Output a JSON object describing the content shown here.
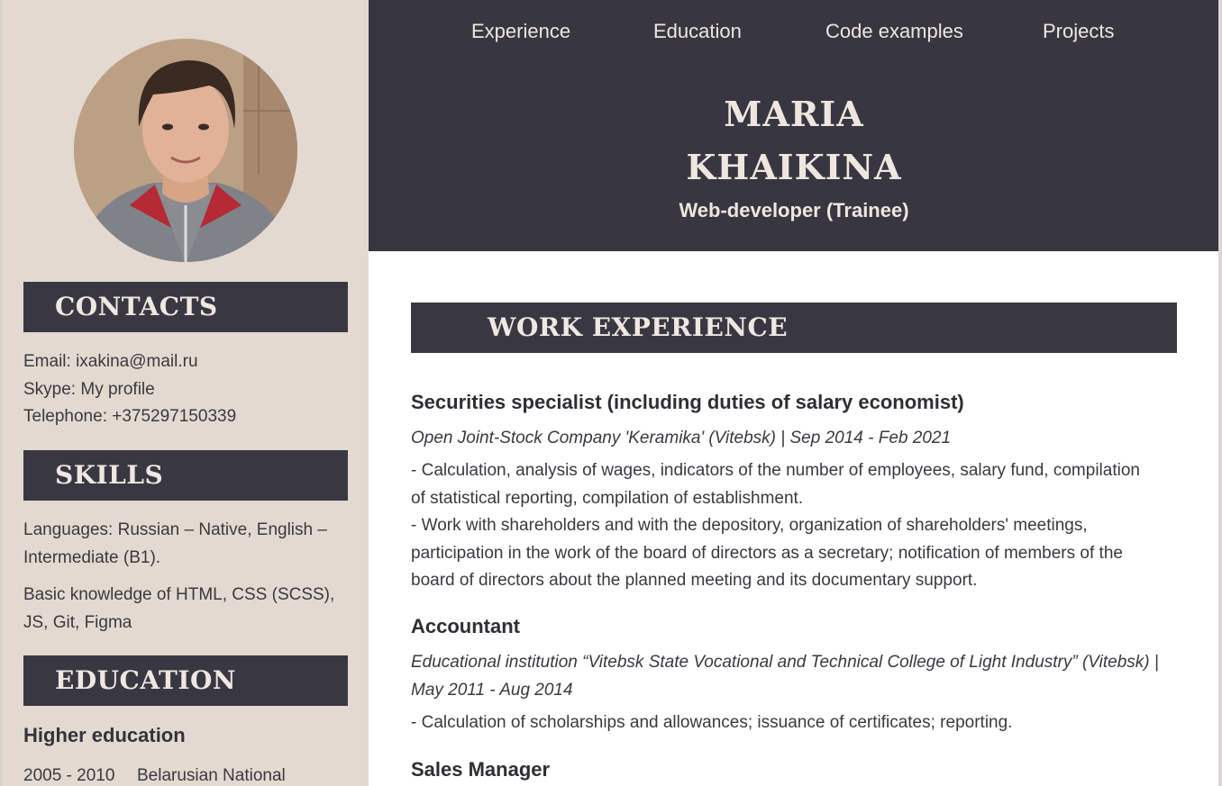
{
  "nav": {
    "items": [
      "Experience",
      "Education",
      "Code examples",
      "Projects"
    ]
  },
  "header": {
    "first_name": "MARIA",
    "last_name": "KHAIKINA",
    "role": "Web-developer (Trainee)"
  },
  "sidebar": {
    "contacts": {
      "heading": "CONTACTS",
      "email": "Email: ixakina@mail.ru",
      "skype": "Skype: My profile",
      "telephone": "Telephone: +375297150339"
    },
    "skills": {
      "heading": "SKILLS",
      "languages_lines": [
        "Languages: Russian – Native, English –",
        "Intermediate (B1)."
      ],
      "knowledge_lines": [
        "Basic knowledge of HTML, CSS (SCSS),",
        "JS, Git, Figma"
      ]
    },
    "education": {
      "heading": "EDUCATION",
      "sub_heading": "Higher education",
      "entry_years": "2005 - 2010",
      "entry_place": "Belarusian National"
    }
  },
  "main": {
    "work_heading": "WORK EXPERIENCE",
    "jobs": [
      {
        "title": "Securities specialist (including duties of salary economist)",
        "company_lines": [
          "Open Joint-Stock Company 'Keramika' (Vitebsk) | Sep 2014 - Feb 2021"
        ],
        "desc_lines": [
          "- Calculation, analysis of wages, indicators of the number of employees, salary fund, compilation",
          "of statistical reporting, compilation of establishment.",
          "- Work with shareholders and with the depository, organization of shareholders' meetings,",
          "participation in the work of the board of directors as a secretary; notification of members of the",
          "board of directors about the planned meeting and its documentary support."
        ]
      },
      {
        "title": "Accountant",
        "company_lines": [
          "Educational institution “Vitebsk State Vocational and Technical College of Light Industry” (Vitebsk) |",
          "May 2011 - Aug 2014"
        ],
        "desc_lines": [
          "- Calculation of scholarships and allowances; issuance of certificates; reporting."
        ]
      },
      {
        "title": "Sales Manager"
      }
    ]
  },
  "colors": {
    "sidebar_bg": "#e3d9d0",
    "header_bg": "#383741",
    "heading_bg": "#393842",
    "heading_text": "#efe7e1"
  }
}
